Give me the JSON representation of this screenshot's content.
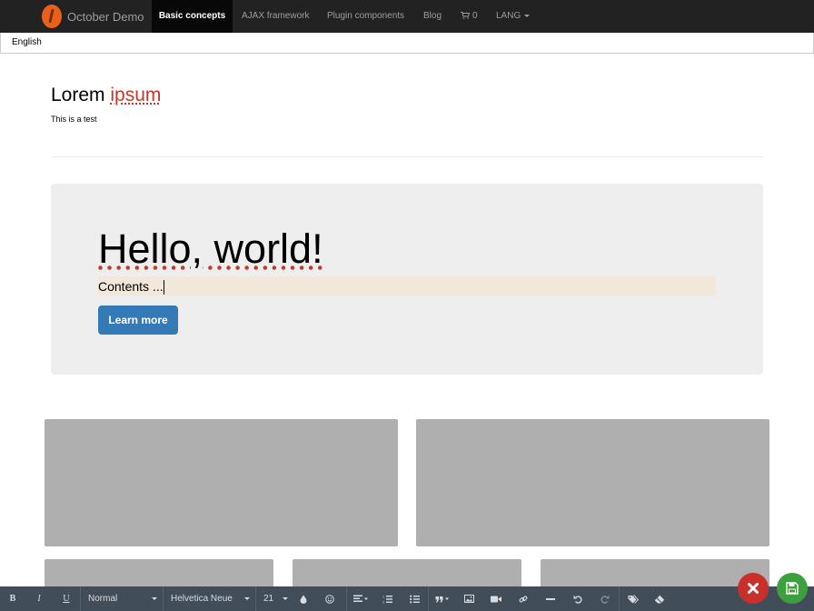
{
  "navbar": {
    "brand": "October Demo",
    "items": [
      {
        "label": "Basic concepts"
      },
      {
        "label": "AJAX framework"
      },
      {
        "label": "Plugin components"
      },
      {
        "label": "Blog"
      },
      {
        "label": "0"
      },
      {
        "label": "LANG"
      }
    ]
  },
  "lang": {
    "selected": "English"
  },
  "header": {
    "title_part1": "Lorem",
    "title_part2": "ipsum",
    "subtitle": "This is a test"
  },
  "jumbotron": {
    "title": "Hello, world!",
    "content": "Contents ...",
    "button": "Learn more"
  },
  "toolbar": {
    "bold": "B",
    "italic": "I",
    "underline": "U",
    "paragraph_format": "Normal",
    "font_family": "Helvetica Neue",
    "font_size": "21"
  },
  "colors": {
    "navbar": "#222222",
    "accent": "#c0392b",
    "primary": "#337ab7",
    "cancel": "#c9302c",
    "save": "#3e9f3e",
    "toolbar": "#424d5a"
  }
}
